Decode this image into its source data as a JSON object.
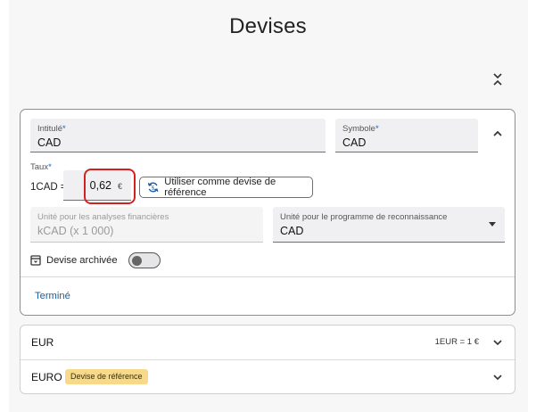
{
  "page": {
    "title": "Devises"
  },
  "card": {
    "intitule": {
      "label": "Intitulé",
      "required_mark": "*",
      "value": "CAD"
    },
    "symbole": {
      "label": "Symbole",
      "required_mark": "*",
      "value": "CAD"
    },
    "taux": {
      "label": "Taux",
      "required_mark": "*",
      "prefix": "1CAD =",
      "value": "0,62",
      "unit": "€"
    },
    "reference_button": {
      "label": "Utiliser comme devise de référence",
      "icon": "currency-exchange-icon"
    },
    "unite_analyses": {
      "label": "Unité pour les analyses financières",
      "placeholder": "kCAD (x 1 000)"
    },
    "unite_programme": {
      "label": "Unité pour le programme de reconnaissance",
      "value": "CAD"
    },
    "archived": {
      "label": "Devise archivée",
      "checked": false,
      "icon": "archive-icon"
    },
    "done_label": "Terminé"
  },
  "currencies": [
    {
      "code": "EUR",
      "rate": "1EUR = 1 €",
      "badge": ""
    },
    {
      "code": "EURO",
      "rate": "",
      "badge": "Devise de référence"
    }
  ],
  "colors": {
    "accent": "#1565c0",
    "highlight": "#d32020",
    "badge": "#f8d98a",
    "link": "#1a5c9e"
  }
}
